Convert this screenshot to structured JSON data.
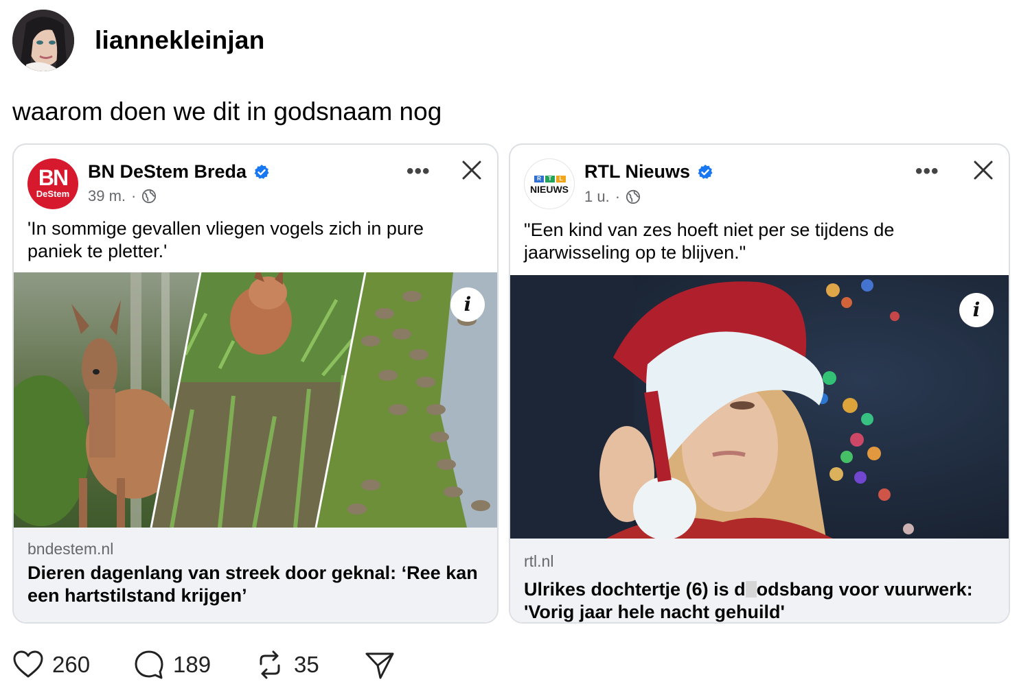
{
  "post": {
    "username": "liannekleinjan",
    "text": "waarom doen we dit in godsnaam nog"
  },
  "cards": [
    {
      "page_name": "BN DeStem Breda",
      "logo_text_top": "BN",
      "logo_text_bottom": "DeStem",
      "time": "39 m.",
      "separator": "·",
      "caption": "'In sommige gevallen vliegen vogels zich in pure paniek te pletter.'",
      "domain": "bndestem.nl",
      "headline": "Dieren dagenlang van streek door geknal: ‘Ree kan een hartstilstand krijgen’",
      "info_label": "i",
      "more_label": "•••",
      "brand_color": "#d7192d"
    },
    {
      "page_name": "RTL Nieuws",
      "logo_text_bottom": "NIEUWS",
      "logo_letters": [
        "R",
        "T",
        "L"
      ],
      "time": "1 u.",
      "separator": "·",
      "caption": "\"Een kind van zes hoeft niet per se tijdens de jaarwisseling op te blijven.\"",
      "domain": "rtl.nl",
      "headline_part1": "Ulrikes dochtertje (6) is d",
      "headline_part2": "odsbang voor vuurwerk:",
      "headline_line2": "'Vorig jaar hele nacht gehuild'",
      "info_label": "i",
      "more_label": "•••"
    }
  ],
  "actions": {
    "likes": "260",
    "comments": "189",
    "reposts": "35"
  },
  "colors": {
    "verified": "#1877f2",
    "link_bg": "#f0f2f5",
    "muted": "#65676b"
  },
  "icons": [
    "heart-icon",
    "comment-icon",
    "repost-icon",
    "share-icon",
    "globe-icon",
    "verified-icon",
    "close-icon",
    "info-icon"
  ]
}
